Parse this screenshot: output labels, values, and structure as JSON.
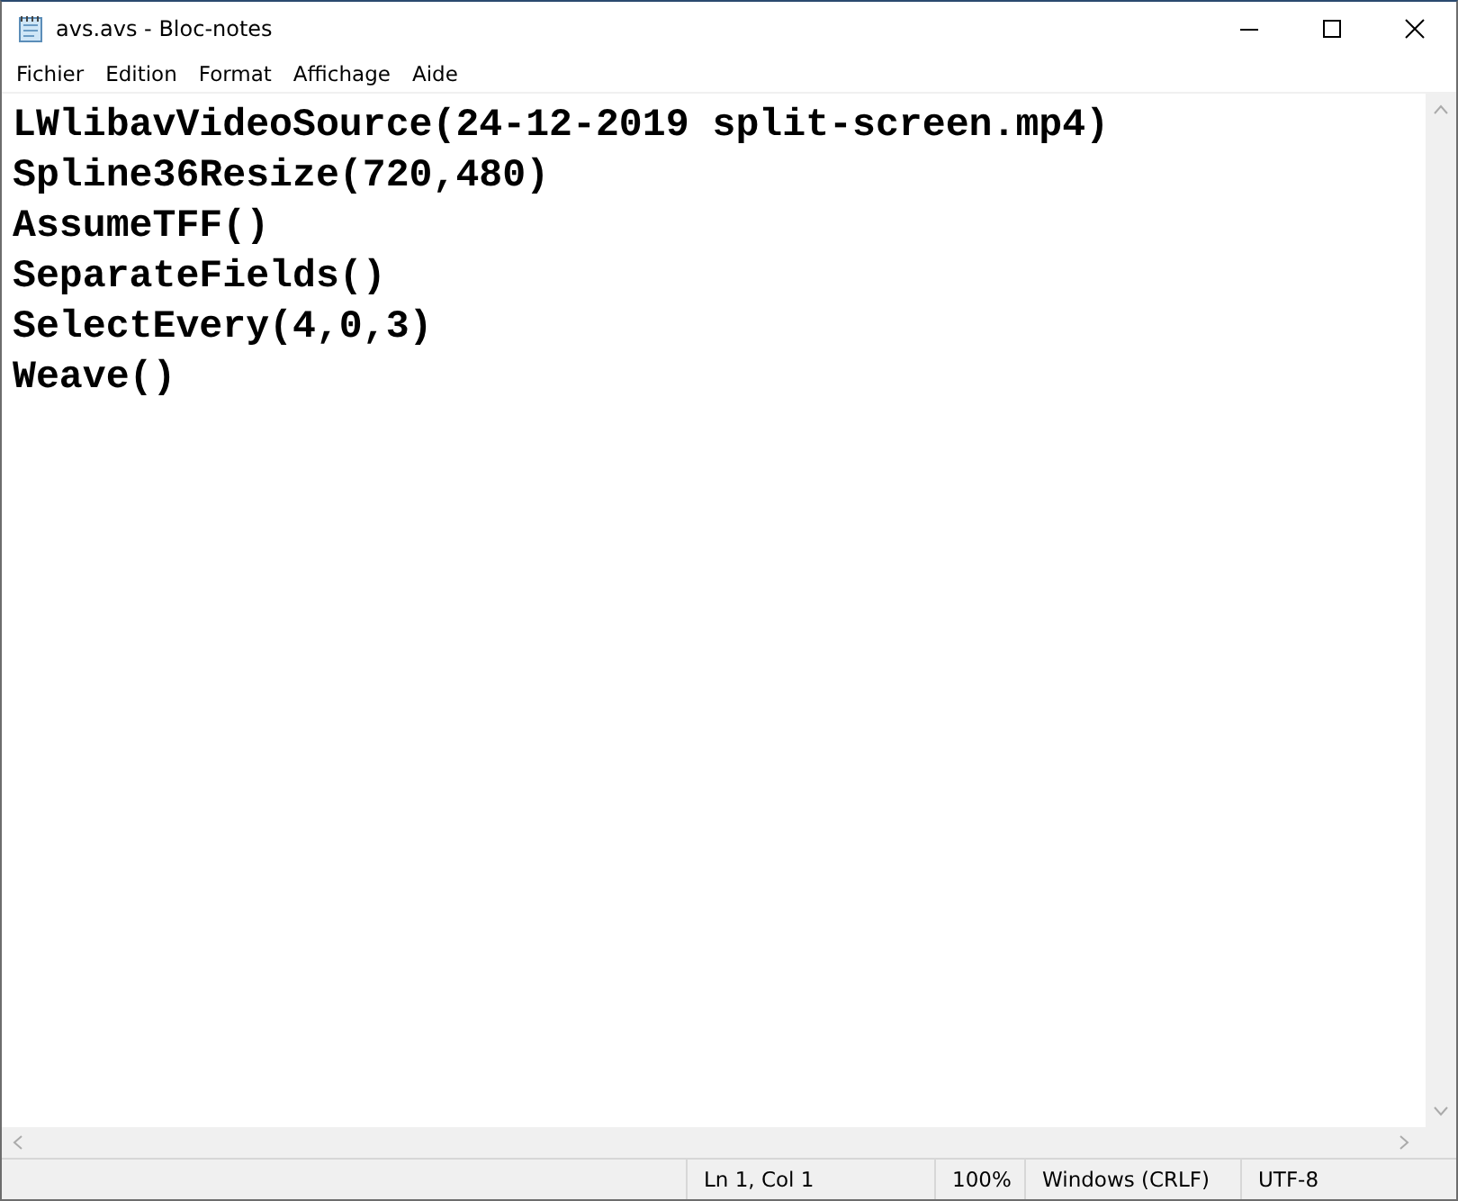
{
  "window": {
    "title": "avs.avs - Bloc-notes"
  },
  "menu": [
    "Fichier",
    "Edition",
    "Format",
    "Affichage",
    "Aide"
  ],
  "editor": {
    "lines": [
      "LWlibavVideoSource(24-12-2019 split-screen.mp4)",
      "Spline36Resize(720,480)",
      "AssumeTFF()",
      "SeparateFields()",
      "SelectEvery(4,0,3)",
      "Weave()"
    ]
  },
  "status_bar": {
    "position": "Ln 1, Col 1",
    "zoom": "100%",
    "line_endings": "Windows (CRLF)",
    "encoding": "UTF-8"
  }
}
